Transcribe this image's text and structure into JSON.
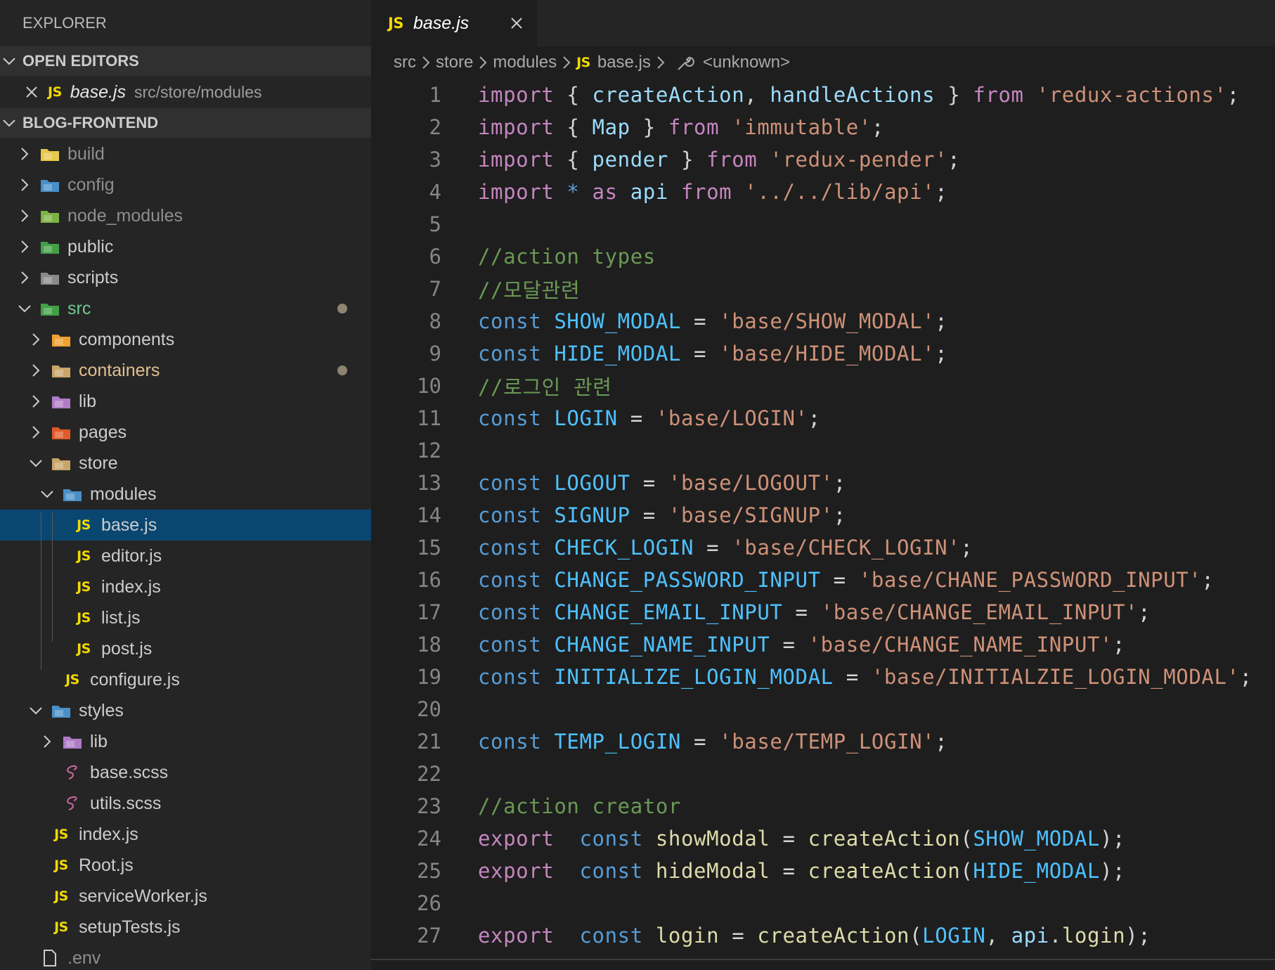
{
  "sidebar": {
    "title": "EXPLORER",
    "open_editors": {
      "header": "OPEN EDITORS",
      "items": [
        {
          "badge": "JS",
          "name": "base.js",
          "path": "src/store/modules"
        }
      ]
    },
    "project": {
      "header": "BLOG-FRONTEND",
      "tree": [
        {
          "label": "build"
        },
        {
          "label": "config"
        },
        {
          "label": "node_modules"
        },
        {
          "label": "public"
        },
        {
          "label": "scripts"
        },
        {
          "label": "src"
        },
        {
          "label": "components"
        },
        {
          "label": "containers"
        },
        {
          "label": "lib"
        },
        {
          "label": "pages"
        },
        {
          "label": "store"
        },
        {
          "label": "modules"
        },
        {
          "label": "base.js",
          "badge": "JS"
        },
        {
          "label": "editor.js",
          "badge": "JS"
        },
        {
          "label": "index.js",
          "badge": "JS"
        },
        {
          "label": "list.js",
          "badge": "JS"
        },
        {
          "label": "post.js",
          "badge": "JS"
        },
        {
          "label": "configure.js",
          "badge": "JS"
        },
        {
          "label": "styles"
        },
        {
          "label": "lib"
        },
        {
          "label": "base.scss"
        },
        {
          "label": "utils.scss"
        },
        {
          "label": "index.js",
          "badge": "JS"
        },
        {
          "label": "Root.js",
          "badge": "JS"
        },
        {
          "label": "serviceWorker.js",
          "badge": "JS"
        },
        {
          "label": "setupTests.js",
          "badge": "JS"
        },
        {
          "label": ".env"
        }
      ]
    }
  },
  "editor": {
    "tab": {
      "badge": "JS",
      "name": "base.js"
    },
    "breadcrumb": [
      "src",
      "store",
      "modules",
      "base.js",
      "<unknown>"
    ],
    "line_numbers": [
      "1",
      "2",
      "3",
      "4",
      "5",
      "6",
      "7",
      "8",
      "9",
      "10",
      "11",
      "12",
      "13",
      "14",
      "15",
      "16",
      "17",
      "18",
      "19",
      "20",
      "21",
      "22",
      "23",
      "24",
      "25",
      "26",
      "27"
    ],
    "code": [
      [
        [
          "kw",
          "import"
        ],
        [
          "",
          "{ "
        ],
        [
          "id",
          "createAction"
        ],
        [
          "",
          ", "
        ],
        [
          "id",
          "handleActions"
        ],
        [
          "",
          "",
          " } "
        ],
        [
          "kw",
          "from"
        ],
        [
          "",
          " "
        ],
        [
          "str",
          "'redux-actions'"
        ],
        [
          "",
          ";"
        ]
      ],
      [
        [
          "kw",
          "import"
        ],
        [
          "",
          "{ "
        ],
        [
          "id",
          "Map"
        ],
        [
          "",
          "",
          " } "
        ],
        [
          "kw",
          "from"
        ],
        [
          "",
          " "
        ],
        [
          "str",
          "'immutable'"
        ],
        [
          "",
          ";"
        ]
      ],
      [
        [
          "kw",
          "import"
        ],
        [
          "",
          "{ "
        ],
        [
          "id",
          "pender"
        ],
        [
          "",
          "",
          " } "
        ],
        [
          "kw",
          "from"
        ],
        [
          "",
          " "
        ],
        [
          "str",
          "'redux-pender'"
        ],
        [
          "",
          ";"
        ]
      ],
      [
        [
          "kw",
          "import"
        ],
        [
          "st",
          "*"
        ],
        [
          "",
          " "
        ],
        [
          "kw",
          "as"
        ],
        [
          "",
          " "
        ],
        [
          "id",
          "api"
        ],
        [
          "",
          " "
        ],
        [
          "kw",
          "from"
        ],
        [
          "",
          " "
        ],
        [
          "str",
          "'../../lib/api'"
        ],
        [
          "",
          ";"
        ]
      ],
      [],
      [
        [
          "cm",
          "//action types"
        ]
      ],
      [
        [
          "cm",
          "//모달관련"
        ]
      ],
      [
        [
          "st",
          "const"
        ],
        [
          "",
          " "
        ],
        [
          "const",
          "SHOW_MODAL"
        ],
        [
          "",
          " = "
        ],
        [
          "str",
          "'base/SHOW_MODAL'"
        ],
        [
          "",
          ";"
        ]
      ],
      [
        [
          "st",
          "const"
        ],
        [
          "",
          " "
        ],
        [
          "const",
          "HIDE_MODAL"
        ],
        [
          "",
          " = "
        ],
        [
          "str",
          "'base/HIDE_MODAL'"
        ],
        [
          "",
          ";"
        ]
      ],
      [
        [
          "cm",
          "//로그인 관련"
        ]
      ],
      [
        [
          "st",
          "const"
        ],
        [
          "",
          " "
        ],
        [
          "const",
          "LOGIN"
        ],
        [
          "",
          " = "
        ],
        [
          "str",
          "'base/LOGIN'"
        ],
        [
          "",
          ";"
        ]
      ],
      [],
      [
        [
          "st",
          "const"
        ],
        [
          "",
          " "
        ],
        [
          "const",
          "LOGOUT"
        ],
        [
          "",
          " = "
        ],
        [
          "str",
          "'base/LOGOUT'"
        ],
        [
          "",
          ";"
        ]
      ],
      [
        [
          "st",
          "const"
        ],
        [
          "",
          " "
        ],
        [
          "const",
          "SIGNUP"
        ],
        [
          "",
          " = "
        ],
        [
          "str",
          "'base/SIGNUP'"
        ],
        [
          "",
          ";"
        ]
      ],
      [
        [
          "st",
          "const"
        ],
        [
          "",
          " "
        ],
        [
          "const",
          "CHECK_LOGIN"
        ],
        [
          "",
          " = "
        ],
        [
          "str",
          "'base/CHECK_LOGIN'"
        ],
        [
          "",
          ";"
        ]
      ],
      [
        [
          "st",
          "const"
        ],
        [
          "",
          " "
        ],
        [
          "const",
          "CHANGE_PASSWORD_INPUT"
        ],
        [
          "",
          " = "
        ],
        [
          "str",
          "'base/CHANE_PASSWORD_INPUT'"
        ],
        [
          "",
          ";"
        ]
      ],
      [
        [
          "st",
          "const"
        ],
        [
          "",
          " "
        ],
        [
          "const",
          "CHANGE_EMAIL_INPUT"
        ],
        [
          "",
          " = "
        ],
        [
          "str",
          "'base/CHANGE_EMAIL_INPUT'"
        ],
        [
          "",
          ";"
        ]
      ],
      [
        [
          "st",
          "const"
        ],
        [
          "",
          " "
        ],
        [
          "const",
          "CHANGE_NAME_INPUT"
        ],
        [
          "",
          " = "
        ],
        [
          "str",
          "'base/CHANGE_NAME_INPUT'"
        ],
        [
          "",
          ";"
        ]
      ],
      [
        [
          "st",
          "const"
        ],
        [
          "",
          " "
        ],
        [
          "const",
          "INITIALIZE_LOGIN_MODAL"
        ],
        [
          "",
          " = "
        ],
        [
          "str",
          "'base/INITIALZIE_LOGIN_MODAL'"
        ],
        [
          "",
          ";"
        ]
      ],
      [],
      [
        [
          "st",
          "const"
        ],
        [
          "",
          " "
        ],
        [
          "const",
          "TEMP_LOGIN"
        ],
        [
          "",
          " = "
        ],
        [
          "str",
          "'base/TEMP_LOGIN'"
        ],
        [
          "",
          ";"
        ]
      ],
      [],
      [
        [
          "cm",
          "//action creator"
        ]
      ],
      [
        [
          "kw",
          "export"
        ],
        [
          "",
          " "
        ],
        [
          "st",
          "const"
        ],
        [
          "",
          " "
        ],
        [
          "fn",
          "showModal"
        ],
        [
          "",
          " = "
        ],
        [
          "fn",
          "createAction"
        ],
        [
          "",
          "("
        ],
        [
          "const",
          "SHOW_MODAL"
        ],
        [
          "",
          ");"
        ]
      ],
      [
        [
          "kw",
          "export"
        ],
        [
          "",
          " "
        ],
        [
          "st",
          "const"
        ],
        [
          "",
          " "
        ],
        [
          "fn",
          "hideModal"
        ],
        [
          "",
          " = "
        ],
        [
          "fn",
          "createAction"
        ],
        [
          "",
          "("
        ],
        [
          "const",
          "HIDE_MODAL"
        ],
        [
          "",
          ");"
        ]
      ],
      [],
      [
        [
          "kw",
          "export"
        ],
        [
          "",
          " "
        ],
        [
          "st",
          "const"
        ],
        [
          "",
          " "
        ],
        [
          "fn",
          "login"
        ],
        [
          "",
          " = "
        ],
        [
          "fn",
          "createAction"
        ],
        [
          "",
          "("
        ],
        [
          "const",
          "LOGIN"
        ],
        [
          "",
          ", "
        ],
        [
          "id",
          "api"
        ],
        [
          "",
          "."
        ],
        [
          "fn",
          "login"
        ],
        [
          "",
          ");"
        ]
      ]
    ]
  },
  "colors": {
    "sidebar_bg": "#252526",
    "editor_bg": "#1e1e1e",
    "selection": "#094771",
    "js_badge": "#f1d900"
  }
}
